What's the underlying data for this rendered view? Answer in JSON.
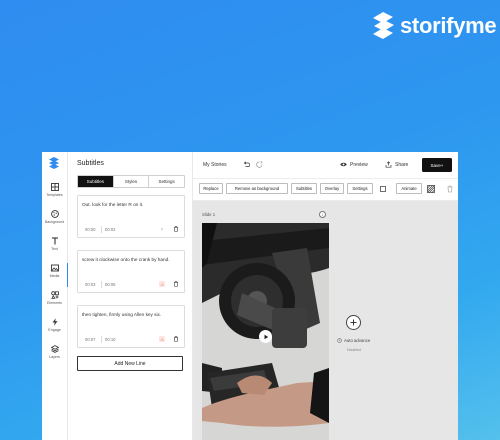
{
  "brand": {
    "name": "storifyme"
  },
  "rail": {
    "items": [
      {
        "label": "Templates",
        "icon": "templates-icon"
      },
      {
        "label": "Background",
        "icon": "palette-icon"
      },
      {
        "label": "Text",
        "icon": "text-icon"
      },
      {
        "label": "Media",
        "icon": "media-icon"
      },
      {
        "label": "Elements",
        "icon": "elements-icon"
      },
      {
        "label": "Engage",
        "icon": "bolt-icon"
      },
      {
        "label": "Layers",
        "icon": "layers-icon"
      }
    ],
    "active": "Media"
  },
  "panel": {
    "title": "Subtitles",
    "tabs": [
      "Subtitles",
      "Styles",
      "Settings"
    ],
    "active_tab": "Subtitles",
    "lines": [
      {
        "text": "Out. look for the letter R on it.",
        "start": "00:00",
        "end": "00:02",
        "fx": "T"
      },
      {
        "text": "screw it clockwise onto the crank by hand.",
        "start": "00:03",
        "end": "00:06",
        "fx": "⚠"
      },
      {
        "text": "then tighten, firmly using Allen key six.",
        "start": "00:07",
        "end": "00:10",
        "fx": "⚠"
      }
    ],
    "add_line_label": "Add New Line"
  },
  "topbar": {
    "story_title": "My Stories",
    "preview_label": "Preview",
    "share_label": "Share",
    "save_label": "Save+"
  },
  "toolbar": {
    "buttons": [
      "Replace",
      "Remove as background",
      "Subtitles",
      "Overlay",
      "Settings",
      "Animate"
    ]
  },
  "canvas": {
    "slide_label": "Slide 1",
    "info_symbol": "i",
    "auto_advance_label": "Auto advance",
    "auto_advance_state": "Disabled"
  },
  "colors": {
    "background_top": "#2f8cf0",
    "background_bottom": "#54c0ec",
    "accent": "#2f8cf0",
    "save_button": "#111111"
  }
}
